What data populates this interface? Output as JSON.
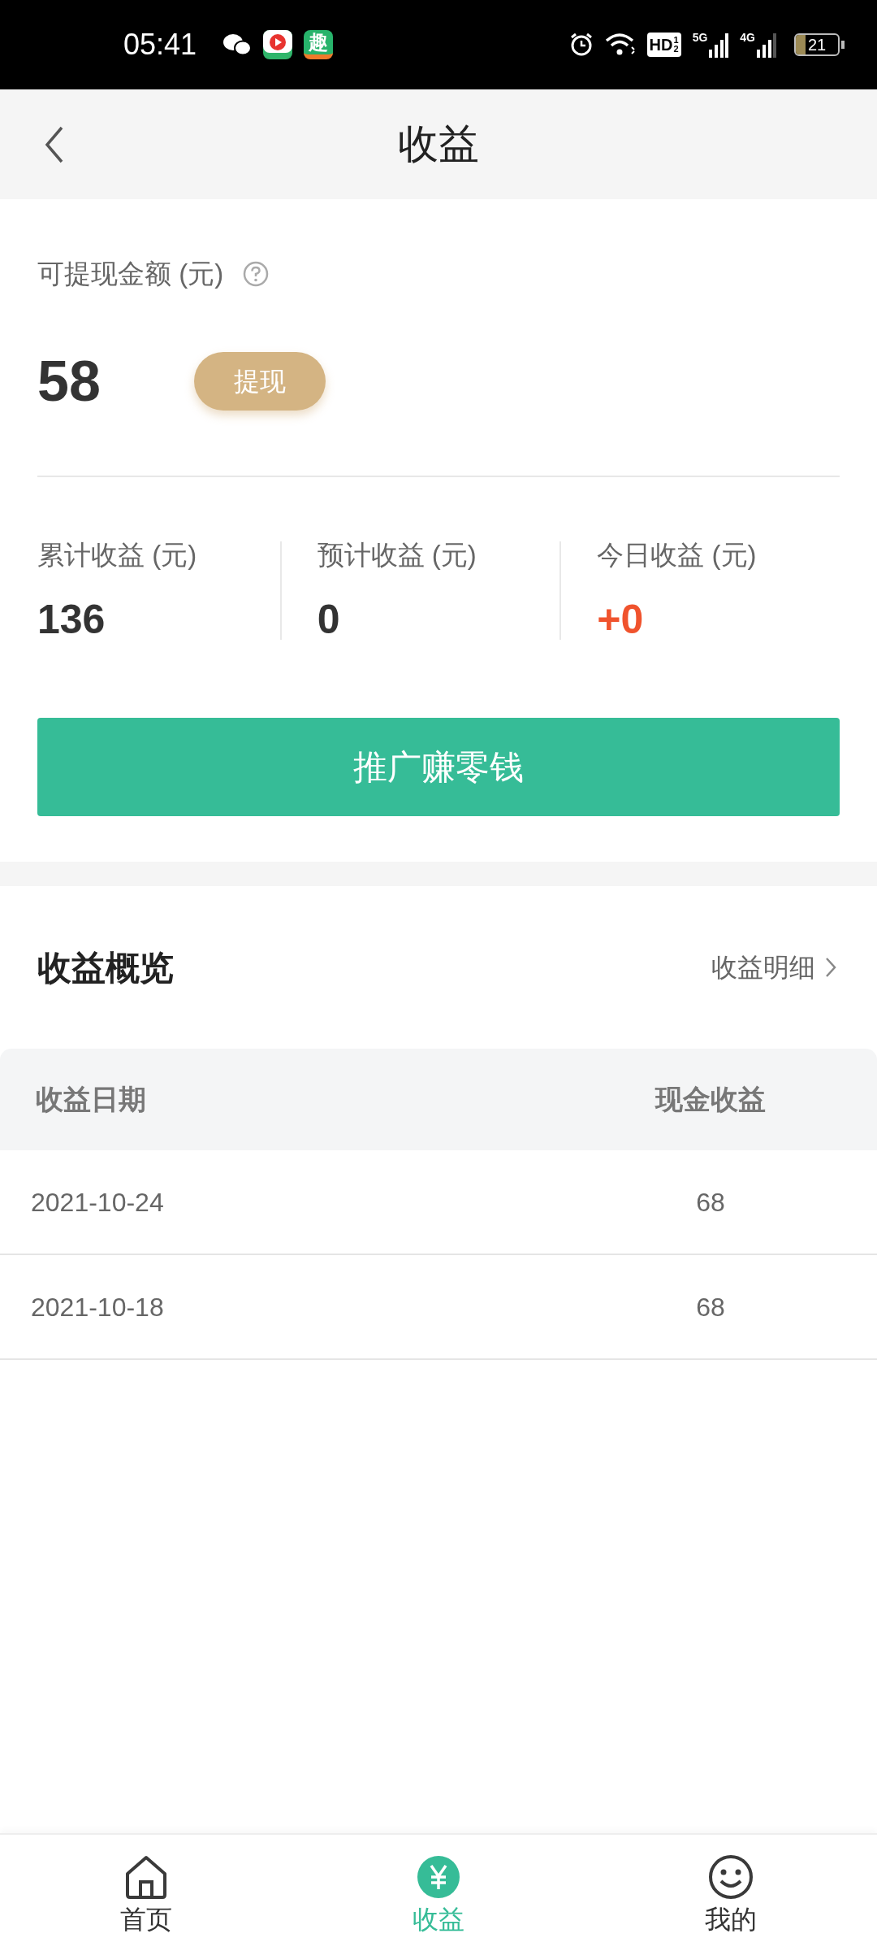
{
  "status_bar": {
    "time": "05:41",
    "hd": "HD",
    "hd_marks": [
      "1",
      "2"
    ],
    "net_1": "5G",
    "net_2": "4G",
    "battery": "21",
    "app_icons": [
      {
        "kind": "chat"
      },
      {
        "kind": "video"
      },
      {
        "kind": "qu",
        "label": "趣"
      }
    ]
  },
  "header": {
    "title": "收益"
  },
  "balance": {
    "label": "可提现金额 (元)",
    "amount": "58",
    "withdraw_button": "提现"
  },
  "stats": [
    {
      "label": "累计收益 (元)",
      "value": "136",
      "highlight": false
    },
    {
      "label": "预计收益 (元)",
      "value": "0",
      "highlight": false
    },
    {
      "label": "今日收益 (元)",
      "value": "+0",
      "highlight": true
    }
  ],
  "promote_button": "推广赚零钱",
  "overview": {
    "title": "收益概览",
    "detail_link": "收益明细",
    "columns": [
      "收益日期",
      "现金收益"
    ],
    "rows": [
      {
        "date": "2021-10-24",
        "amount": "68"
      },
      {
        "date": "2021-10-18",
        "amount": "68"
      }
    ]
  },
  "tab_bar": [
    {
      "label": "首页",
      "kind": "home",
      "selected": false
    },
    {
      "label": "收益",
      "kind": "earnings",
      "selected": true
    },
    {
      "label": "我的",
      "kind": "profile",
      "selected": false
    }
  ]
}
